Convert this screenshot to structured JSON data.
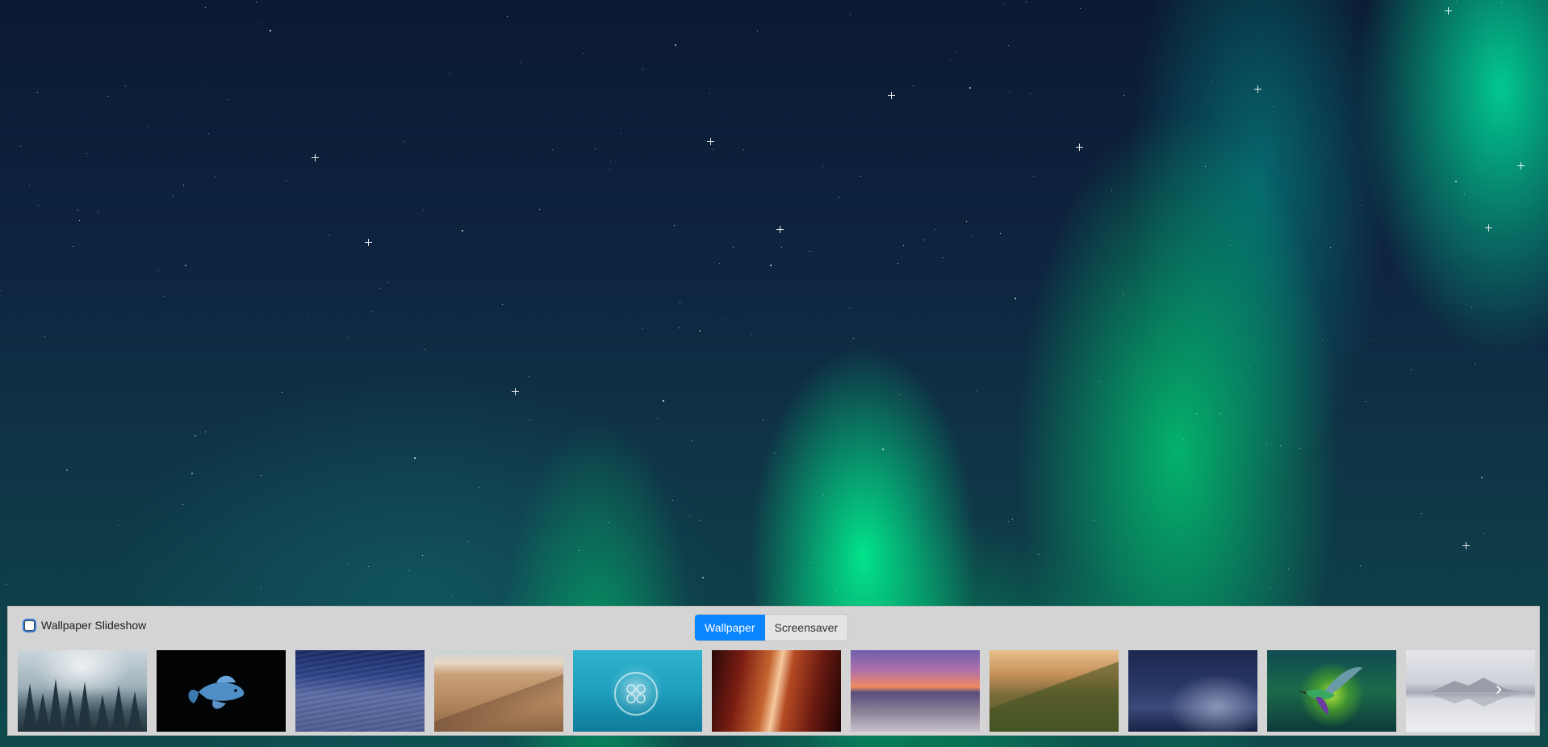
{
  "wallpaper_panel": {
    "slideshow": {
      "label": "Wallpaper Slideshow",
      "checked": false
    },
    "tabs": [
      {
        "label": "Wallpaper",
        "active": true
      },
      {
        "label": "Screensaver",
        "active": false
      }
    ],
    "thumbnails": [
      {
        "subject": "misty pine forest"
      },
      {
        "subject": "blue betta fish on black"
      },
      {
        "subject": "blue sand dune under night sky"
      },
      {
        "subject": "desert dunes at dusk"
      },
      {
        "subject": "jellyfish in turquoise water"
      },
      {
        "subject": "red slot canyon"
      },
      {
        "subject": "purple sunset over coast"
      },
      {
        "subject": "golden mountain valley"
      },
      {
        "subject": "blue dunes at night"
      },
      {
        "subject": "hummingbird on green"
      },
      {
        "subject": "misty lake reflection"
      }
    ],
    "scroll_icon": "chevron-right",
    "scroll_glyph": "›"
  },
  "colors": {
    "accent": "#0a84ff",
    "panel_bg": "#d4d4d4",
    "aurora": "#00ff96"
  }
}
